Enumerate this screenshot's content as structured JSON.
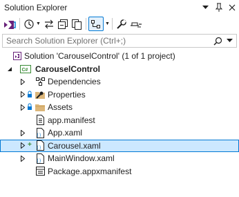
{
  "window": {
    "title": "Solution Explorer"
  },
  "toolbar": {
    "icons": [
      "vs-switch-views-icon",
      "history-icon",
      "sync-icon",
      "collapse-all-icon",
      "show-all-files-icon",
      "preview-selected-icon",
      "properties-wrench-icon",
      "pending-changes-icon"
    ]
  },
  "search": {
    "placeholder": "Search Solution Explorer (Ctrl+;)"
  },
  "tree": {
    "solution": "Solution 'CarouselControl' (1 of 1 project)",
    "project": "CarouselControl",
    "items": [
      {
        "label": "Dependencies"
      },
      {
        "label": "Properties"
      },
      {
        "label": "Assets"
      },
      {
        "label": "app.manifest"
      },
      {
        "label": "App.xaml"
      },
      {
        "label": "Carousel.xaml"
      },
      {
        "label": "MainWindow.xaml"
      },
      {
        "label": "Package.appxmanifest"
      }
    ],
    "selected": "Carousel.xaml"
  },
  "colors": {
    "accent": "#0078d4",
    "selection": "#cce8ff",
    "folder": "#dcb67a",
    "csharp_project": "#388a34"
  }
}
